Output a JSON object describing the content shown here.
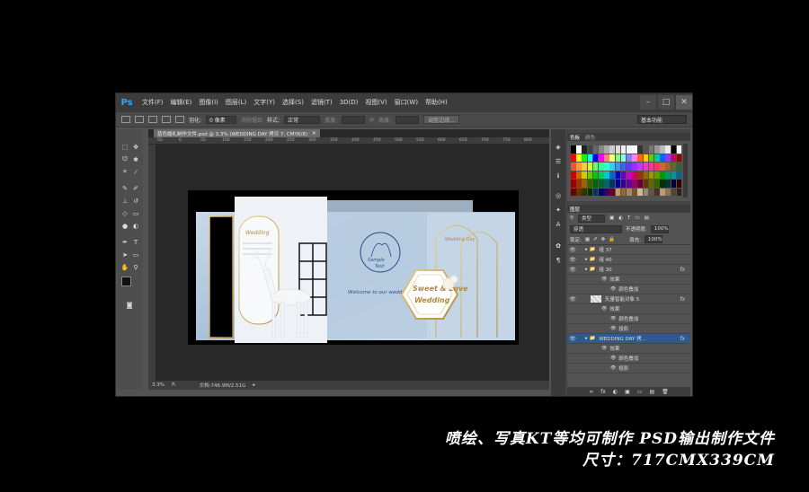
{
  "app": {
    "logo": "Ps",
    "menu": [
      "文件(F)",
      "编辑(E)",
      "图像(I)",
      "图层(L)",
      "文字(Y)",
      "选择(S)",
      "滤镜(T)",
      "3D(D)",
      "视图(V)",
      "窗口(W)",
      "帮助(H)"
    ],
    "window_controls": [
      "–",
      "□",
      "✕"
    ]
  },
  "options_bar": {
    "feather_label": "羽化:",
    "feather_value": "0 像素",
    "antialias_label": "消除锯齿",
    "style_label": "样式:",
    "style_value": "正常",
    "width_label": "宽度:",
    "height_label": "高度:",
    "refine_button": "调整边缘...",
    "workspace": "基本功能"
  },
  "document": {
    "tab_title": "蓝色婚礼制作文件.psd @ 3.3% (WEDDING DAY 拷贝 7, CMYK/8)",
    "ruler_marks": [
      "50",
      "0",
      "50",
      "100",
      "150",
      "200",
      "250",
      "300",
      "350",
      "400",
      "450",
      "500",
      "550",
      "600",
      "650",
      "700",
      "750",
      "800"
    ],
    "zoom": "3.3%",
    "doc_size": "文档:746.9M/2.51G",
    "artwork": {
      "monogram_line1": "Sample",
      "monogram_line2": "Text",
      "welcome": "Welcome to our wedding",
      "sweet_line1": "Sweet & Love",
      "sweet_line2": "Wedding",
      "small_title1": "Wedding",
      "small_title2": "Wedding Day"
    }
  },
  "swatches_panel": {
    "tabs": [
      "色板",
      "颜色"
    ]
  },
  "layers_panel": {
    "tab": "图层",
    "filter_kind": "类型",
    "blend_mode": "穿透",
    "opacity_label": "不透明度:",
    "opacity_value": "100%",
    "lock_label": "锁定:",
    "fill_label": "填充:",
    "fill_value": "100%",
    "rows": [
      {
        "name": "组 37",
        "kind": "group",
        "fx": ""
      },
      {
        "name": "组 40",
        "kind": "group",
        "fx": ""
      },
      {
        "name": "组 30",
        "kind": "group",
        "fx": "fx"
      },
      {
        "name": "效果",
        "kind": "effect",
        "fx": ""
      },
      {
        "name": "颜色叠加",
        "kind": "sub",
        "fx": ""
      },
      {
        "name": "矢量智能对象 5",
        "kind": "smart",
        "fx": "fx"
      },
      {
        "name": "效果",
        "kind": "effect",
        "fx": ""
      },
      {
        "name": "颜色叠加",
        "kind": "sub",
        "fx": ""
      },
      {
        "name": "投影",
        "kind": "sub",
        "fx": ""
      },
      {
        "name": "WEDDING DAY 拷...",
        "kind": "group-sel",
        "fx": "fx"
      },
      {
        "name": "效果",
        "kind": "effect",
        "fx": ""
      },
      {
        "name": "颜色叠加",
        "kind": "sub",
        "fx": ""
      },
      {
        "name": "投影",
        "kind": "sub",
        "fx": ""
      }
    ],
    "footer_icons": [
      "∞",
      "fx",
      "◐",
      "▣",
      "▭",
      "▤",
      "🗑"
    ]
  },
  "captions": {
    "line1": "喷绘、写真KT等均可制作   PSD输出制作文件",
    "line2": "尺寸：717CMX339CM"
  },
  "colors": {
    "accent_blue": "#31a8ff",
    "gold": "#c9a55a",
    "artwork_blue": "#a9c1d8"
  }
}
